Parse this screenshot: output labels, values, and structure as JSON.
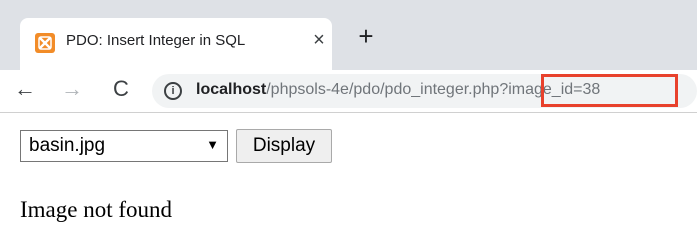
{
  "browser": {
    "tab": {
      "title": "PDO: Insert Integer in SQL",
      "close_glyph": "×"
    },
    "new_tab_glyph": "+",
    "nav": {
      "back_glyph": "←",
      "forward_glyph": "→",
      "reload_glyph": "C"
    },
    "address_bar": {
      "info_glyph": "i",
      "host": "localhost",
      "path": "/phpsols-4e/pdo/pdo_integer.php?image_id=38"
    },
    "highlight_color": "#e8412c",
    "favicon_color": "#f28c28"
  },
  "page": {
    "image_select": {
      "selected": "basin.jpg",
      "arrow_glyph": "▼"
    },
    "display_button_label": "Display",
    "message": "Image not found"
  }
}
